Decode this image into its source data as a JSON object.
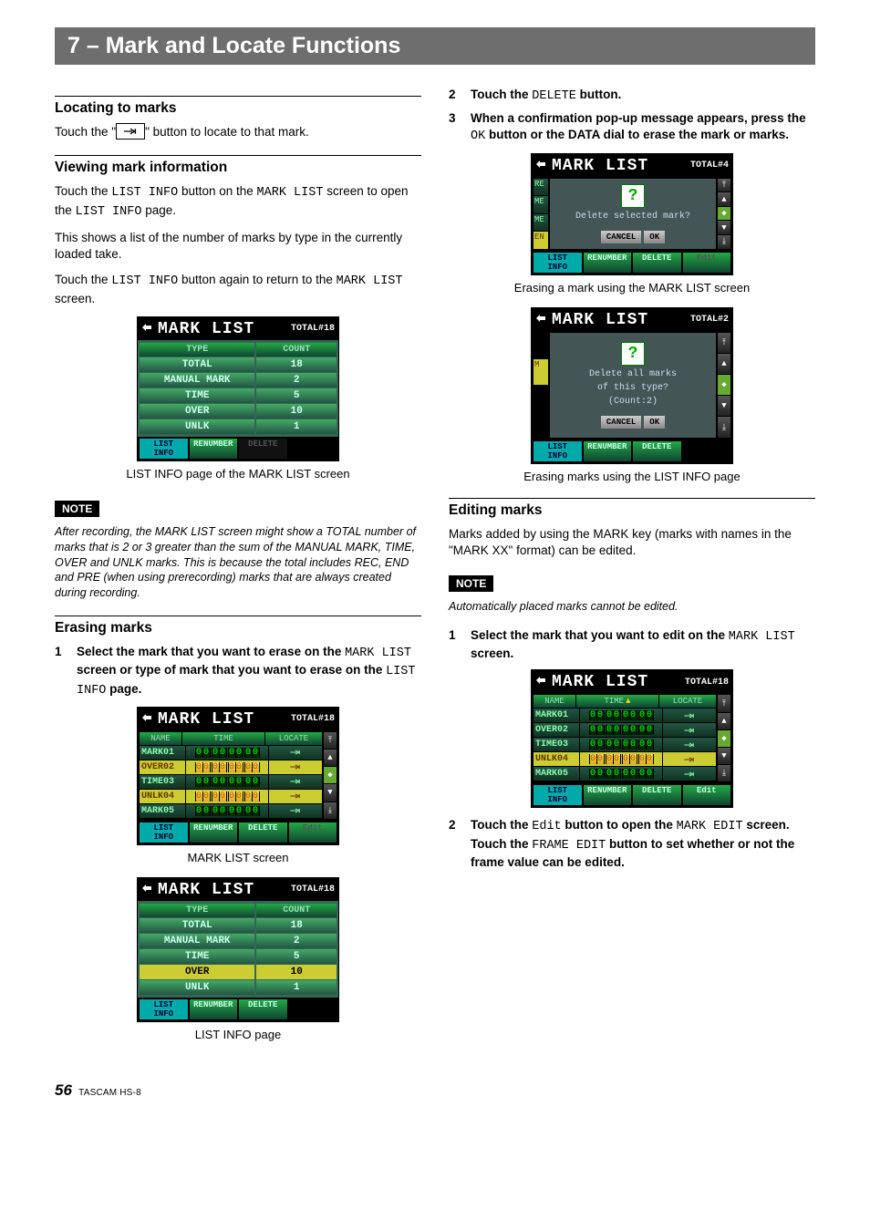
{
  "chapter_title": "7 – Mark and Locate Functions",
  "left": {
    "locating": {
      "heading": "Locating to marks",
      "p1_a": "Touch the \"",
      "p1_b": "\" button to locate to that mark."
    },
    "viewing": {
      "heading": "Viewing mark information",
      "p1_a": "Touch the ",
      "p1_b": " button on the ",
      "p1_c": " screen to open the ",
      "p1_d": " page.",
      "kw_listinfo": "LIST INFO",
      "kw_marklist": "MARK LIST",
      "p2": "This shows a list of the number of marks by type in the currently loaded take.",
      "p3_a": "Touch the ",
      "p3_b": " button again to return to the ",
      "p3_c": " screen.",
      "caption": "LIST INFO page of the MARK LIST screen",
      "note_label": "NOTE",
      "note_text": "After recording, the MARK LIST screen might show a TOTAL number of marks that is 2 or 3 greater than the sum of the MANUAL MARK, TIME, OVER and UNLK marks. This is because the total includes REC, END and PRE (when using prerecording) marks that are always created during recording."
    },
    "erasing": {
      "heading": "Erasing marks",
      "step1_a": "Select the mark that you want to erase on the ",
      "step1_b": " screen or type of mark that you want to erase on the ",
      "step1_c": " page.",
      "caption_ml": "MARK LIST screen",
      "caption_li": "LIST INFO page"
    }
  },
  "right": {
    "step2_a": "Touch the ",
    "step2_b": " button.",
    "kw_delete": "DELETE",
    "step3_a": "When a confirmation pop-up message appears, press the ",
    "step3_b": " button or the DATA dial to erase the mark or marks.",
    "kw_ok": "OK",
    "caption_erase_ml": "Erasing a mark using the MARK LIST screen",
    "caption_erase_li": "Erasing marks using the LIST INFO page",
    "editing": {
      "heading": "Editing marks",
      "p1": "Marks added by using the MARK key (marks with names in the \"MARK XX\" format) can be edited.",
      "note_label": "NOTE",
      "note_text": "Automatically placed marks cannot be edited.",
      "step1_a": "Select the mark that you want to edit on the ",
      "step1_b": " screen.",
      "kw_marklist": "MARK LIST",
      "step2_a": "Touch the ",
      "step2_kw_edit": "Edit",
      "step2_b": " button to open the ",
      "step2_kw_markedit": "MARK EDIT",
      "step2_c": " screen. Touch the ",
      "step2_kw_frameedit": "FRAME EDIT",
      "step2_d": " button to set whether or not the frame value can be edited."
    }
  },
  "screens": {
    "marklist_title": "MARK LIST",
    "total18": "TOTAL#18",
    "total4": "TOTAL#4",
    "total2": "TOTAL#2",
    "listinfo": {
      "head_type": "TYPE",
      "head_count": "COUNT",
      "rows": [
        {
          "type": "TOTAL",
          "count": "18"
        },
        {
          "type": "MANUAL MARK",
          "count": "2"
        },
        {
          "type": "TIME",
          "count": "5"
        },
        {
          "type": "OVER",
          "count": "10"
        },
        {
          "type": "UNLK",
          "count": "1"
        }
      ]
    },
    "marklist_cols": {
      "name": "NAME",
      "time": "TIME",
      "locate": "LOCATE"
    },
    "marklist_rows": [
      {
        "name": "MARK01",
        "time": "00.00.00.00"
      },
      {
        "name": "OVER02",
        "time": "00.00.00.00"
      },
      {
        "name": "TIME03",
        "time": "00.00.00.00"
      },
      {
        "name": "UNLK04",
        "time": "00.00.00.00"
      },
      {
        "name": "MARK05",
        "time": "00.00.00.00"
      }
    ],
    "footer": {
      "listinfo": "LIST\nINFO",
      "renumber": "RENUMBER",
      "delete": "DELETE",
      "edit": "Edit"
    },
    "dialog1": {
      "msg": "Delete selected mark?",
      "cancel": "CANCEL",
      "ok": "OK",
      "left": [
        "RE",
        "ME",
        "ME",
        "EN"
      ]
    },
    "dialog2": {
      "msg1": "Delete all marks",
      "msg2": "of this type?",
      "msg3": "(Count:2)",
      "cancel": "CANCEL",
      "ok": "OK",
      "left": [
        "M"
      ]
    }
  },
  "footer": {
    "page": "56",
    "product": "TASCAM  HS-8"
  }
}
